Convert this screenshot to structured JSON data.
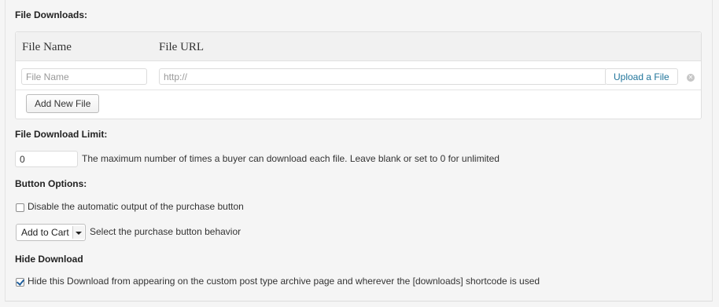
{
  "file_downloads": {
    "title": "File Downloads:",
    "columns": {
      "name": "File Name",
      "url": "File URL"
    },
    "row": {
      "name_placeholder": "File Name",
      "url_placeholder": "http://",
      "upload_label": "Upload a File",
      "remove_icon": "close-circle-icon"
    },
    "add_button": "Add New File"
  },
  "download_limit": {
    "title": "File Download Limit:",
    "value": "0",
    "help": "The maximum number of times a buyer can download each file. Leave blank or set to 0 for unlimited"
  },
  "button_options": {
    "title": "Button Options:",
    "disable_label": "Disable the automatic output of the purchase button",
    "disable_checked": false,
    "behavior_selected": "Add to Cart",
    "behavior_help": "Select the purchase button behavior"
  },
  "hide_download": {
    "title": "Hide Download",
    "label": "Hide this Download from appearing on the custom post type archive page and wherever the [downloads] shortcode is used",
    "checked": true
  }
}
